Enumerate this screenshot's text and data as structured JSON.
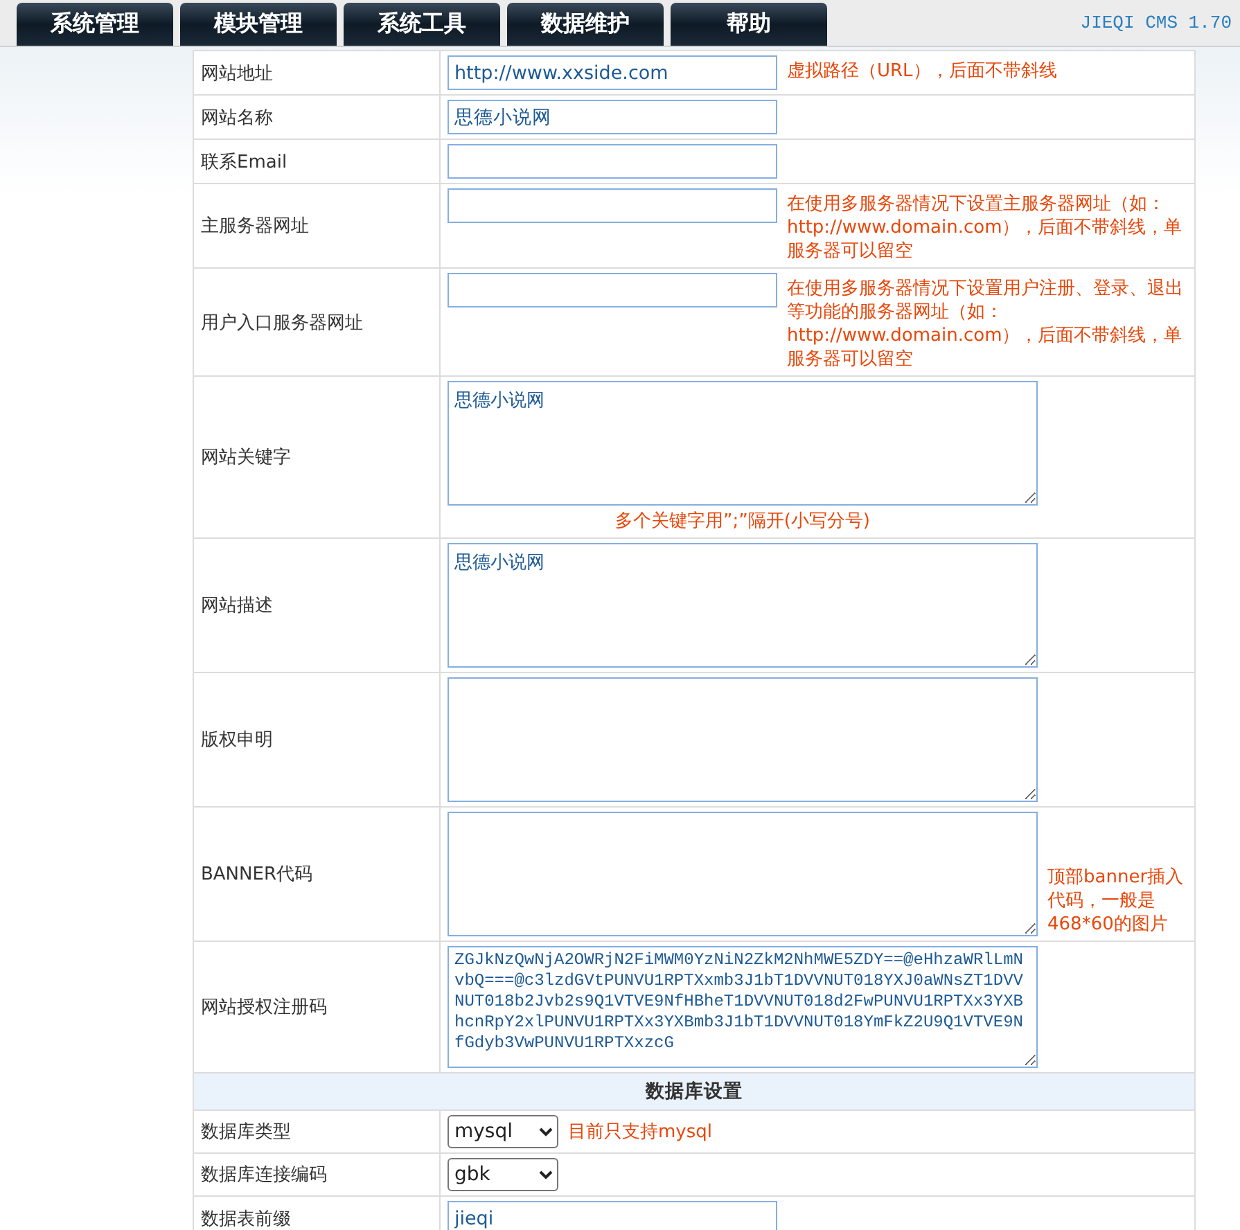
{
  "nav": {
    "tabs": [
      {
        "label": "系统管理",
        "selected": false
      },
      {
        "label": "模块管理",
        "selected": false
      },
      {
        "label": "系统工具",
        "selected": false
      },
      {
        "label": "数据维护",
        "selected": false
      },
      {
        "label": "帮助",
        "selected": false
      }
    ],
    "version": "JIEQI CMS 1.70"
  },
  "rows": [
    {
      "kind": "input",
      "label": "网站地址",
      "value": "http://www.xxside.com",
      "hint": "虚拟路径（URL），后面不带斜线"
    },
    {
      "kind": "input",
      "label": "网站名称",
      "value": "思德小说网"
    },
    {
      "kind": "input",
      "label": "联系Email"
    },
    {
      "kind": "input",
      "label": "主服务器网址",
      "hint": "在使用多服务器情况下设置主服务器网址（如：http://www.domain.com），后面不带斜线，单服务器可以留空"
    },
    {
      "kind": "input",
      "label": "用户入口服务器网址",
      "hint": "在使用多服务器情况下设置用户注册、登录、退出等功能的服务器网址（如：http://www.domain.com），后面不带斜线，单服务器可以留空"
    },
    {
      "kind": "textarea",
      "label": "网站关键字",
      "value": "思德小说网",
      "note": "多个关键字用”;”隔开(小写分号)"
    },
    {
      "kind": "textarea",
      "label": "网站描述",
      "value": "思德小说网"
    },
    {
      "kind": "textarea",
      "label": "版权申明"
    },
    {
      "kind": "textarea",
      "label": "BANNER代码",
      "hint": "顶部banner插入代码，一般是468*60的图片"
    },
    {
      "kind": "code",
      "label": "网站授权注册码",
      "value": "ZGJkNzQwNjA2OWRjN2FiMWM0YzNiN2ZkM2NhMWE5ZDY==@eHhzaWRlLmNvbQ===@c3lzdGVtPUNVU1RPTXxmb3J1bT1DVVNUT018YXJ0aWNsZT1DVVNUT018b2Jvb2s9Q1VTVE9NfHBheT1DVVNUT018d2FwPUNVU1RPTXx3YXBhcnRpY2xlPUNVU1RPTXx3YXBmb3J1bT1DVVNUT018YmFkZ2U9Q1VTVE9NfGdyb3VwPUNVU1RPTXxzcG"
    },
    {
      "kind": "section",
      "label": "数据库设置"
    },
    {
      "kind": "select",
      "label": "数据库类型",
      "value": "mysql",
      "hint": "目前只支持mysql"
    },
    {
      "kind": "select",
      "label": "数据库连接编码",
      "value": "gbk"
    },
    {
      "kind": "input",
      "label": "数据表前缀",
      "value": "jieqi"
    }
  ]
}
